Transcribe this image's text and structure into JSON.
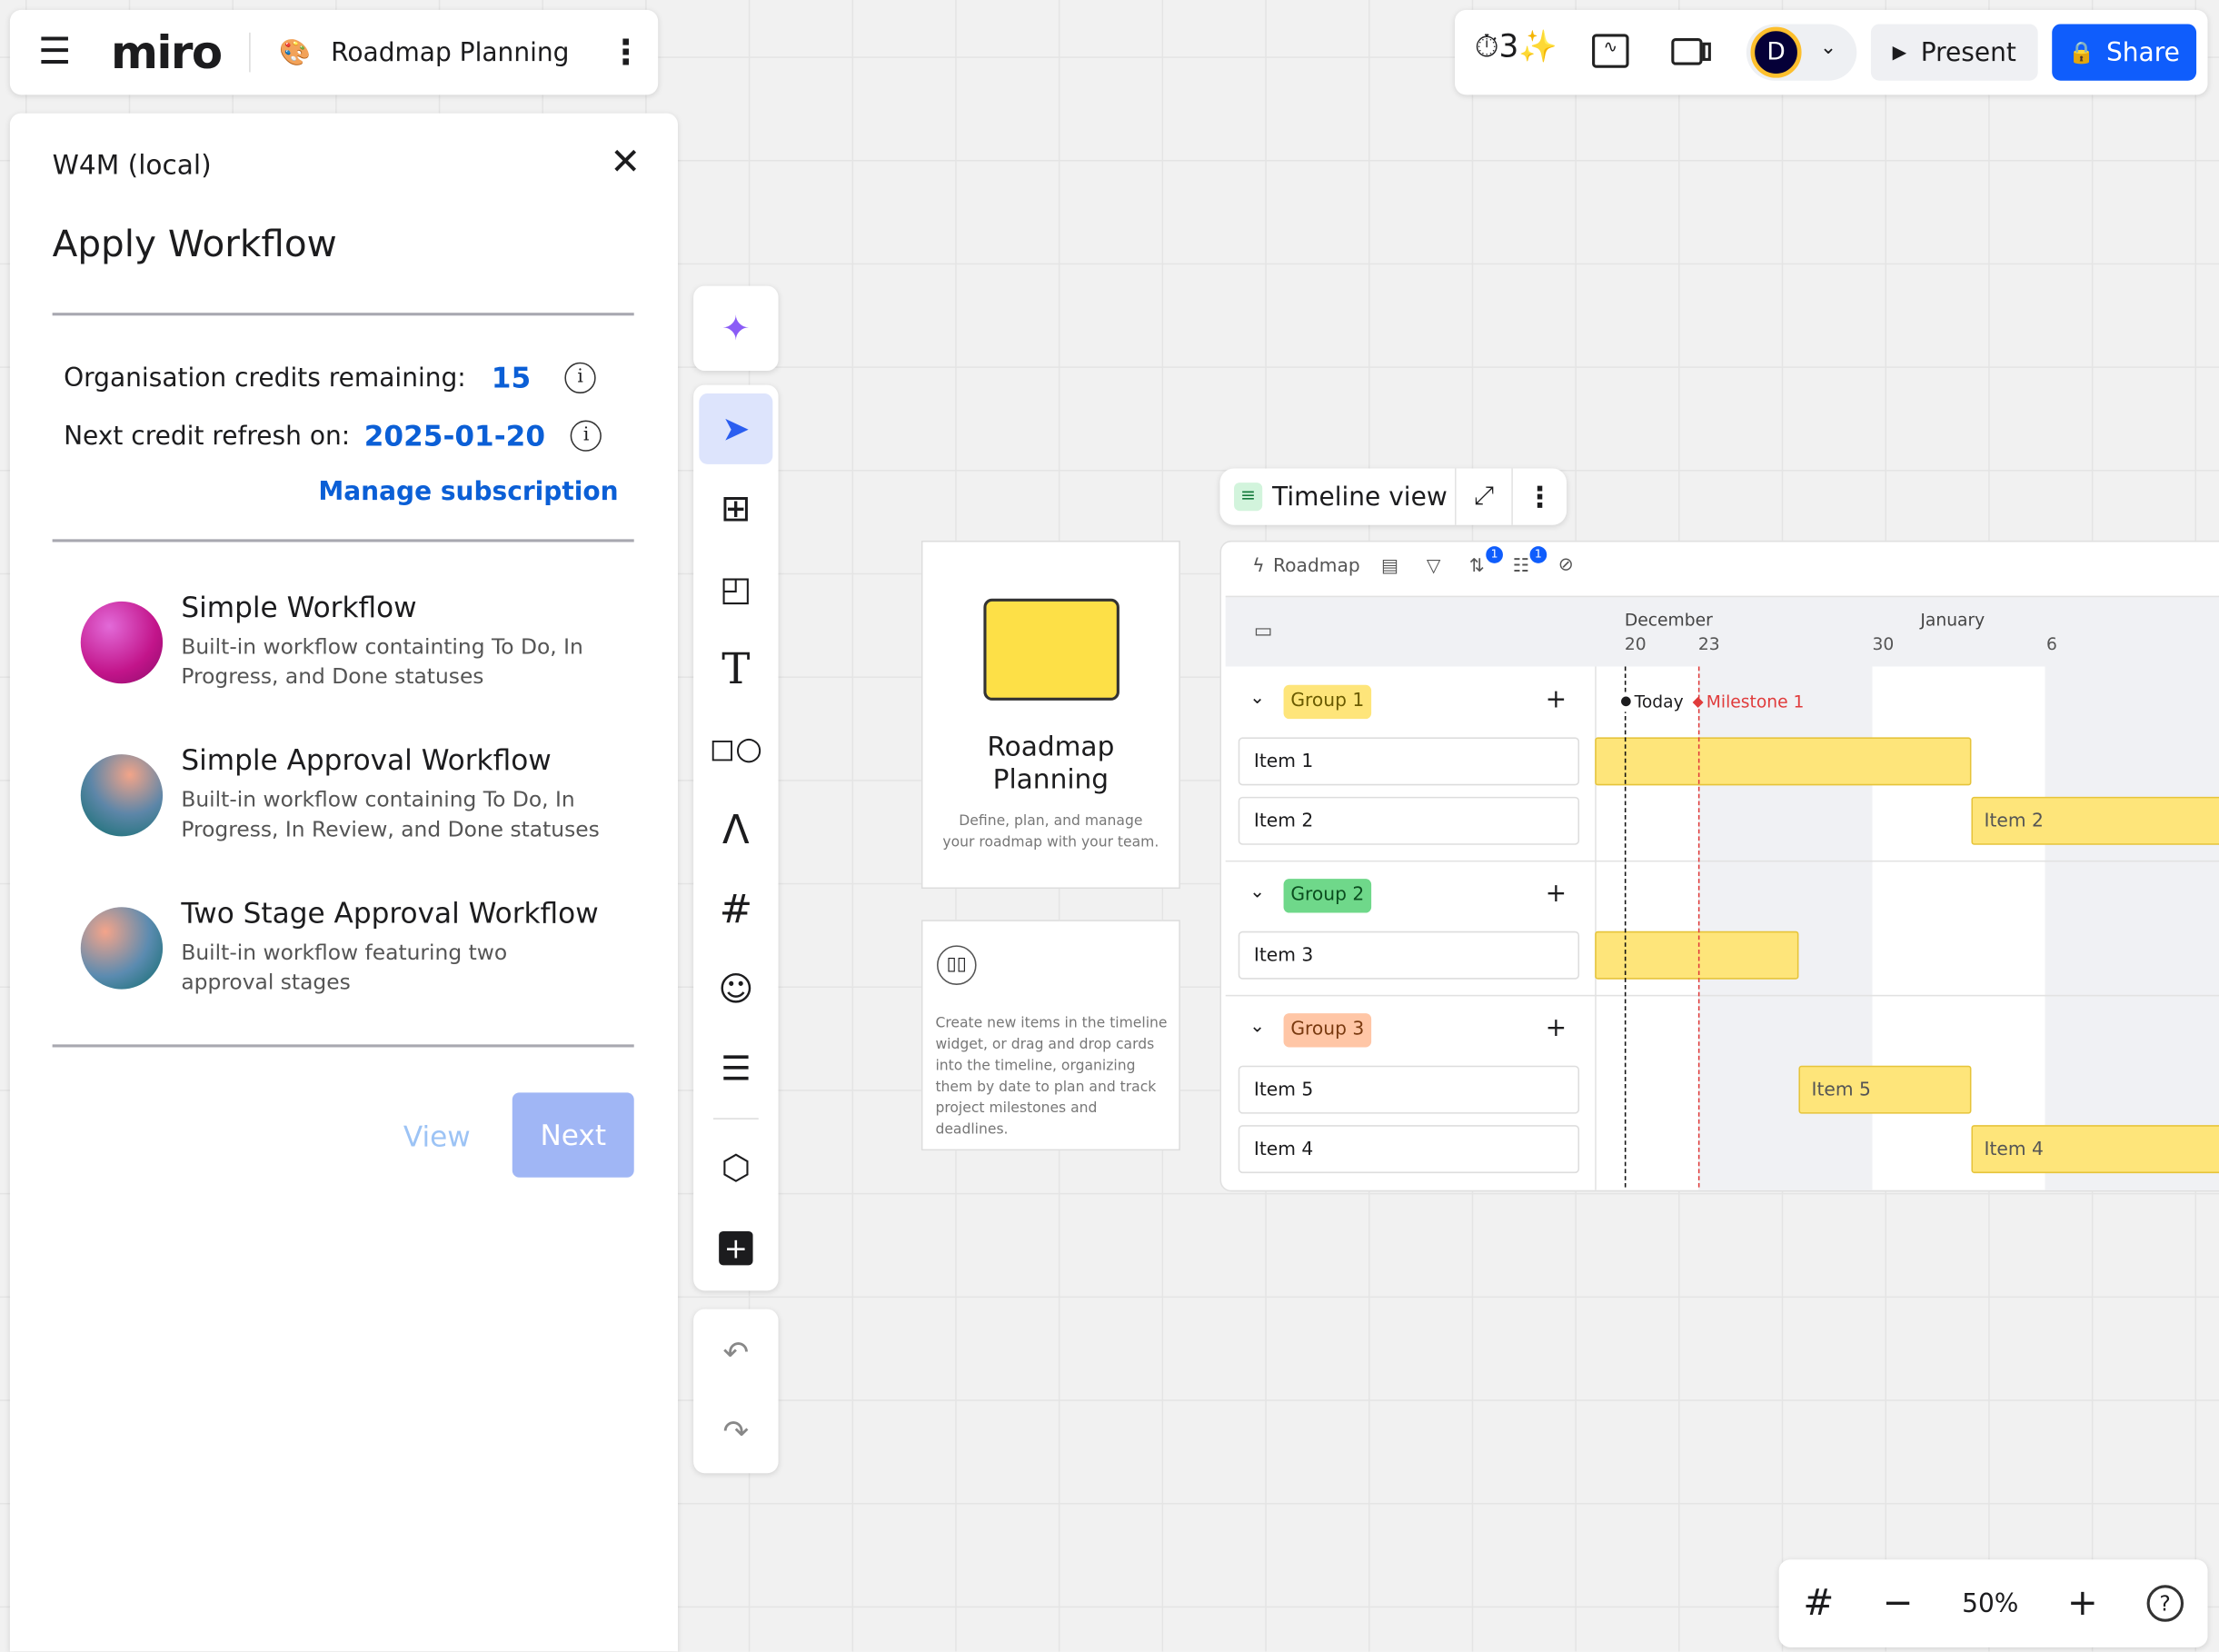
{
  "header": {
    "logo": "miro",
    "board_title": "Roadmap Planning",
    "present_label": "Present",
    "share_label": "Share",
    "avatar_initial": "D"
  },
  "panel": {
    "app_name": "W4M (local)",
    "title": "Apply Workflow",
    "credits_label": "Organisation credits remaining:",
    "credits_value": "15",
    "refresh_label": "Next credit refresh on:",
    "refresh_value": "2025-01-20",
    "manage_link": "Manage subscription",
    "workflows": [
      {
        "title": "Simple Workflow",
        "desc": "Built-in workflow containting To Do, In Progress, and Done statuses"
      },
      {
        "title": "Simple Approval Workflow",
        "desc": "Built-in workflow containing To Do, In Progress, In Review, and Done statuses"
      },
      {
        "title": "Two Stage Approval Workflow",
        "desc": "Built-in workflow featuring two approval stages"
      }
    ],
    "view_label": "View",
    "next_label": "Next"
  },
  "cards": {
    "title": "Roadmap Planning",
    "subtitle": "Define, plan, and manage your roadmap with your team.",
    "help": "Create new items in the timeline widget, or drag and drop cards into the timeline, organizing them by date to plan and track project milestones and deadlines."
  },
  "timeline": {
    "view_label": "Timeline view",
    "roadmap_label": "Roadmap",
    "sort_badge": "1",
    "group_badge": "1",
    "months": [
      "December",
      "January"
    ],
    "days": [
      "20",
      "23",
      "30",
      "6"
    ],
    "today_label": "Today",
    "milestone_label": "Milestone 1",
    "groups": [
      {
        "label": "Group 1",
        "color": "#fee57a"
      },
      {
        "label": "Group 2",
        "color": "#6fd88a"
      },
      {
        "label": "Group 3",
        "color": "#ffc6a6"
      }
    ],
    "rows": [
      "Item 1",
      "Item 2",
      "Item 3",
      "Item 5",
      "Item 4"
    ],
    "bars": [
      "",
      "Item 2",
      "",
      "Item 5",
      "Item 4"
    ]
  },
  "zoom": {
    "level": "50%"
  },
  "colors": {
    "accent": "#0f5dfc",
    "bar": "#fee57a",
    "milestone": "#e03b3b"
  }
}
